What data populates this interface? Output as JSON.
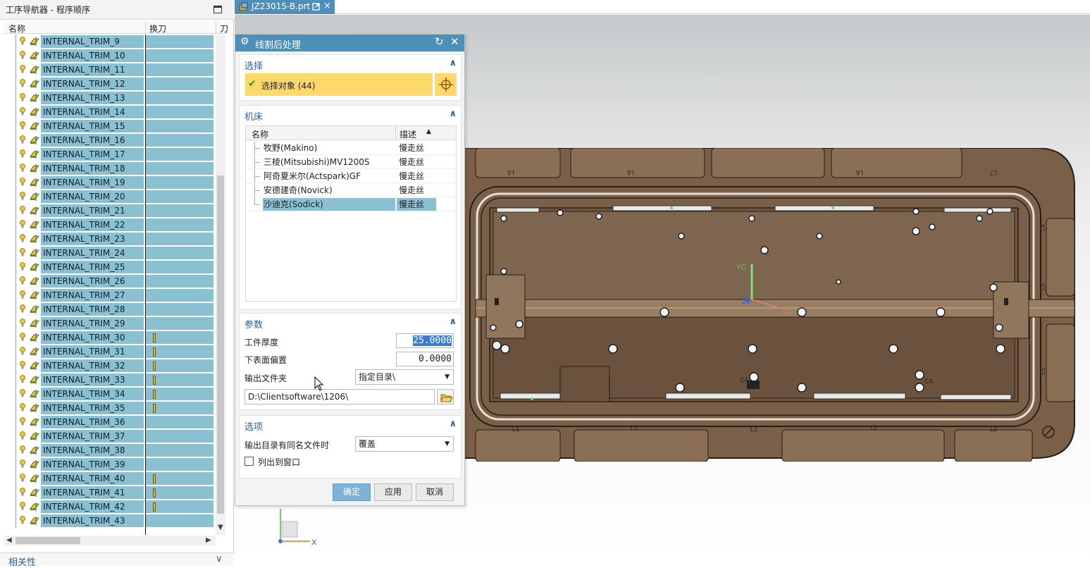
{
  "navigator": {
    "title": "工序导航器 - 程序顺序",
    "col_name": "名称",
    "col_toolchange": "换刀",
    "col_more": "刀",
    "rows": [
      {
        "name": "INTERNAL_TRIM_9",
        "tool_change": false
      },
      {
        "name": "INTERNAL_TRIM_10",
        "tool_change": false
      },
      {
        "name": "INTERNAL_TRIM_11",
        "tool_change": false
      },
      {
        "name": "INTERNAL_TRIM_12",
        "tool_change": false
      },
      {
        "name": "INTERNAL_TRIM_13",
        "tool_change": false
      },
      {
        "name": "INTERNAL_TRIM_14",
        "tool_change": false
      },
      {
        "name": "INTERNAL_TRIM_15",
        "tool_change": false
      },
      {
        "name": "INTERNAL_TRIM_16",
        "tool_change": false
      },
      {
        "name": "INTERNAL_TRIM_17",
        "tool_change": false
      },
      {
        "name": "INTERNAL_TRIM_18",
        "tool_change": false
      },
      {
        "name": "INTERNAL_TRIM_19",
        "tool_change": false
      },
      {
        "name": "INTERNAL_TRIM_20",
        "tool_change": false
      },
      {
        "name": "INTERNAL_TRIM_21",
        "tool_change": false
      },
      {
        "name": "INTERNAL_TRIM_22",
        "tool_change": false
      },
      {
        "name": "INTERNAL_TRIM_23",
        "tool_change": false
      },
      {
        "name": "INTERNAL_TRIM_24",
        "tool_change": false
      },
      {
        "name": "INTERNAL_TRIM_25",
        "tool_change": false
      },
      {
        "name": "INTERNAL_TRIM_26",
        "tool_change": false
      },
      {
        "name": "INTERNAL_TRIM_27",
        "tool_change": false
      },
      {
        "name": "INTERNAL_TRIM_28",
        "tool_change": false
      },
      {
        "name": "INTERNAL_TRIM_29",
        "tool_change": false
      },
      {
        "name": "INTERNAL_TRIM_30",
        "tool_change": true
      },
      {
        "name": "INTERNAL_TRIM_31",
        "tool_change": true
      },
      {
        "name": "INTERNAL_TRIM_32",
        "tool_change": true
      },
      {
        "name": "INTERNAL_TRIM_33",
        "tool_change": true
      },
      {
        "name": "INTERNAL_TRIM_34",
        "tool_change": true
      },
      {
        "name": "INTERNAL_TRIM_35",
        "tool_change": true
      },
      {
        "name": "INTERNAL_TRIM_36",
        "tool_change": false
      },
      {
        "name": "INTERNAL_TRIM_37",
        "tool_change": false
      },
      {
        "name": "INTERNAL_TRIM_38",
        "tool_change": false
      },
      {
        "name": "INTERNAL_TRIM_39",
        "tool_change": false
      },
      {
        "name": "INTERNAL_TRIM_40",
        "tool_change": true
      },
      {
        "name": "INTERNAL_TRIM_41",
        "tool_change": true
      },
      {
        "name": "INTERNAL_TRIM_42",
        "tool_change": true
      },
      {
        "name": "INTERNAL_TRIM_43",
        "tool_change": false
      }
    ],
    "related_label": "相关性"
  },
  "tab": {
    "label": "JZ23015-B.prt",
    "close": "×"
  },
  "dialog": {
    "title": "线割后处理",
    "selection": {
      "header": "选择",
      "label": "选择对象 (44)"
    },
    "machine": {
      "header": "机床",
      "col_name": "名称",
      "col_desc": "描述",
      "rows": [
        {
          "name": "牧野(Makino)",
          "desc": "慢走丝",
          "selected": false
        },
        {
          "name": "三棱(Mitsubishi)MV1200S",
          "desc": "慢走丝",
          "selected": false
        },
        {
          "name": "阿奇夏米尔(Actspark)GF",
          "desc": "慢走丝",
          "selected": false
        },
        {
          "name": "安德建奇(Novick)",
          "desc": "慢走丝",
          "selected": false
        },
        {
          "name": "沙迪克(Sodick)",
          "desc": "慢走丝",
          "selected": true
        }
      ]
    },
    "params": {
      "header": "参数",
      "thickness_label": "工件厚度",
      "thickness_value": "25.0000",
      "offset_label": "下表面偏置",
      "offset_value": "0.0000",
      "folder_label": "输出文件夹",
      "folder_option": "指定目录\\",
      "path_value": "D:\\Clientsoftware\\1206\\"
    },
    "options": {
      "header": "选项",
      "exists_label": "输出目录有同名文件时",
      "exists_option": "覆盖",
      "list_label": "列出到窗口",
      "list_checked": false
    },
    "buttons": {
      "ok": "确定",
      "apply": "应用",
      "cancel": "取消"
    }
  },
  "viewport": {
    "labels": [
      "L6",
      "L6",
      "L6",
      "L7",
      "L1",
      "L2",
      "L2",
      "L2",
      "L3",
      "L4",
      "L5",
      "L5",
      "C4",
      "C4"
    ],
    "wcs": {
      "y": "YC",
      "z": "ZC",
      "x": "XC"
    },
    "triad_x": "X"
  },
  "colors": {
    "accent": "#4c8fb8",
    "selection": "#89c0d2",
    "highlight_bar": "#fcd96a",
    "part": "#7a6048"
  }
}
